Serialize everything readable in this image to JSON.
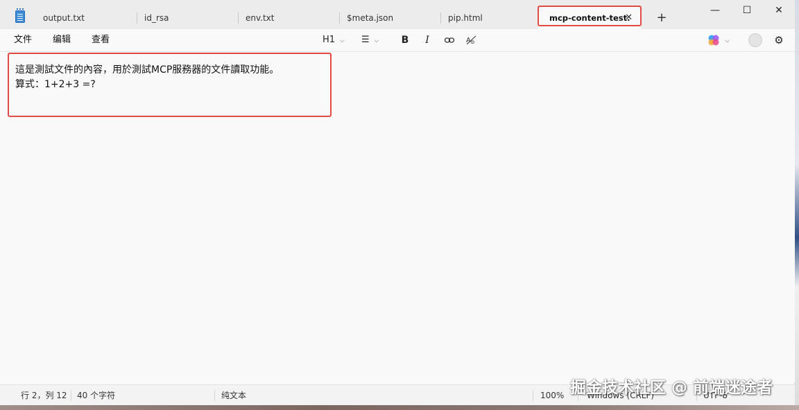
{
  "tabs": [
    {
      "label": "output.txt",
      "active": false
    },
    {
      "label": "id_rsa",
      "active": false
    },
    {
      "label": "env.txt",
      "active": false
    },
    {
      "label": "$meta.json",
      "active": false
    },
    {
      "label": "pip.html",
      "active": false
    },
    {
      "label": "mcp-content-test.",
      "active": true
    }
  ],
  "window_controls": {
    "minimize": "—",
    "maximize": "☐",
    "close": "✕",
    "new_tab": "+",
    "tab_close": "✕"
  },
  "menu": {
    "file": "文件",
    "edit": "编辑",
    "view": "查看"
  },
  "toolbar": {
    "heading": "H1",
    "list_icon": "☰",
    "bold": "B",
    "italic": "I",
    "link_icon": "⊖",
    "spellcheck_icon": "A̶b",
    "chevron": "⌵",
    "settings_icon": "⚙",
    "copilot_icon": "copilot-icon",
    "account_icon": "account-icon"
  },
  "document": {
    "lines": [
      "這是測試文件的內容，用於測試MCP服務器的文件讀取功能。",
      "算式：1+2+3 =?"
    ]
  },
  "status": {
    "position": "行 2，列 12",
    "char_count": "40 个字符",
    "format": "纯文本",
    "zoom": "100%",
    "line_ending": "Windows (CRLF)",
    "encoding": "UTF-8"
  },
  "watermark": "掘金技术社区 @ 前端迷途者",
  "colors": {
    "highlight": "#e24a45",
    "titlebar": "#ececec",
    "editor_bg": "#f9f9f9"
  }
}
